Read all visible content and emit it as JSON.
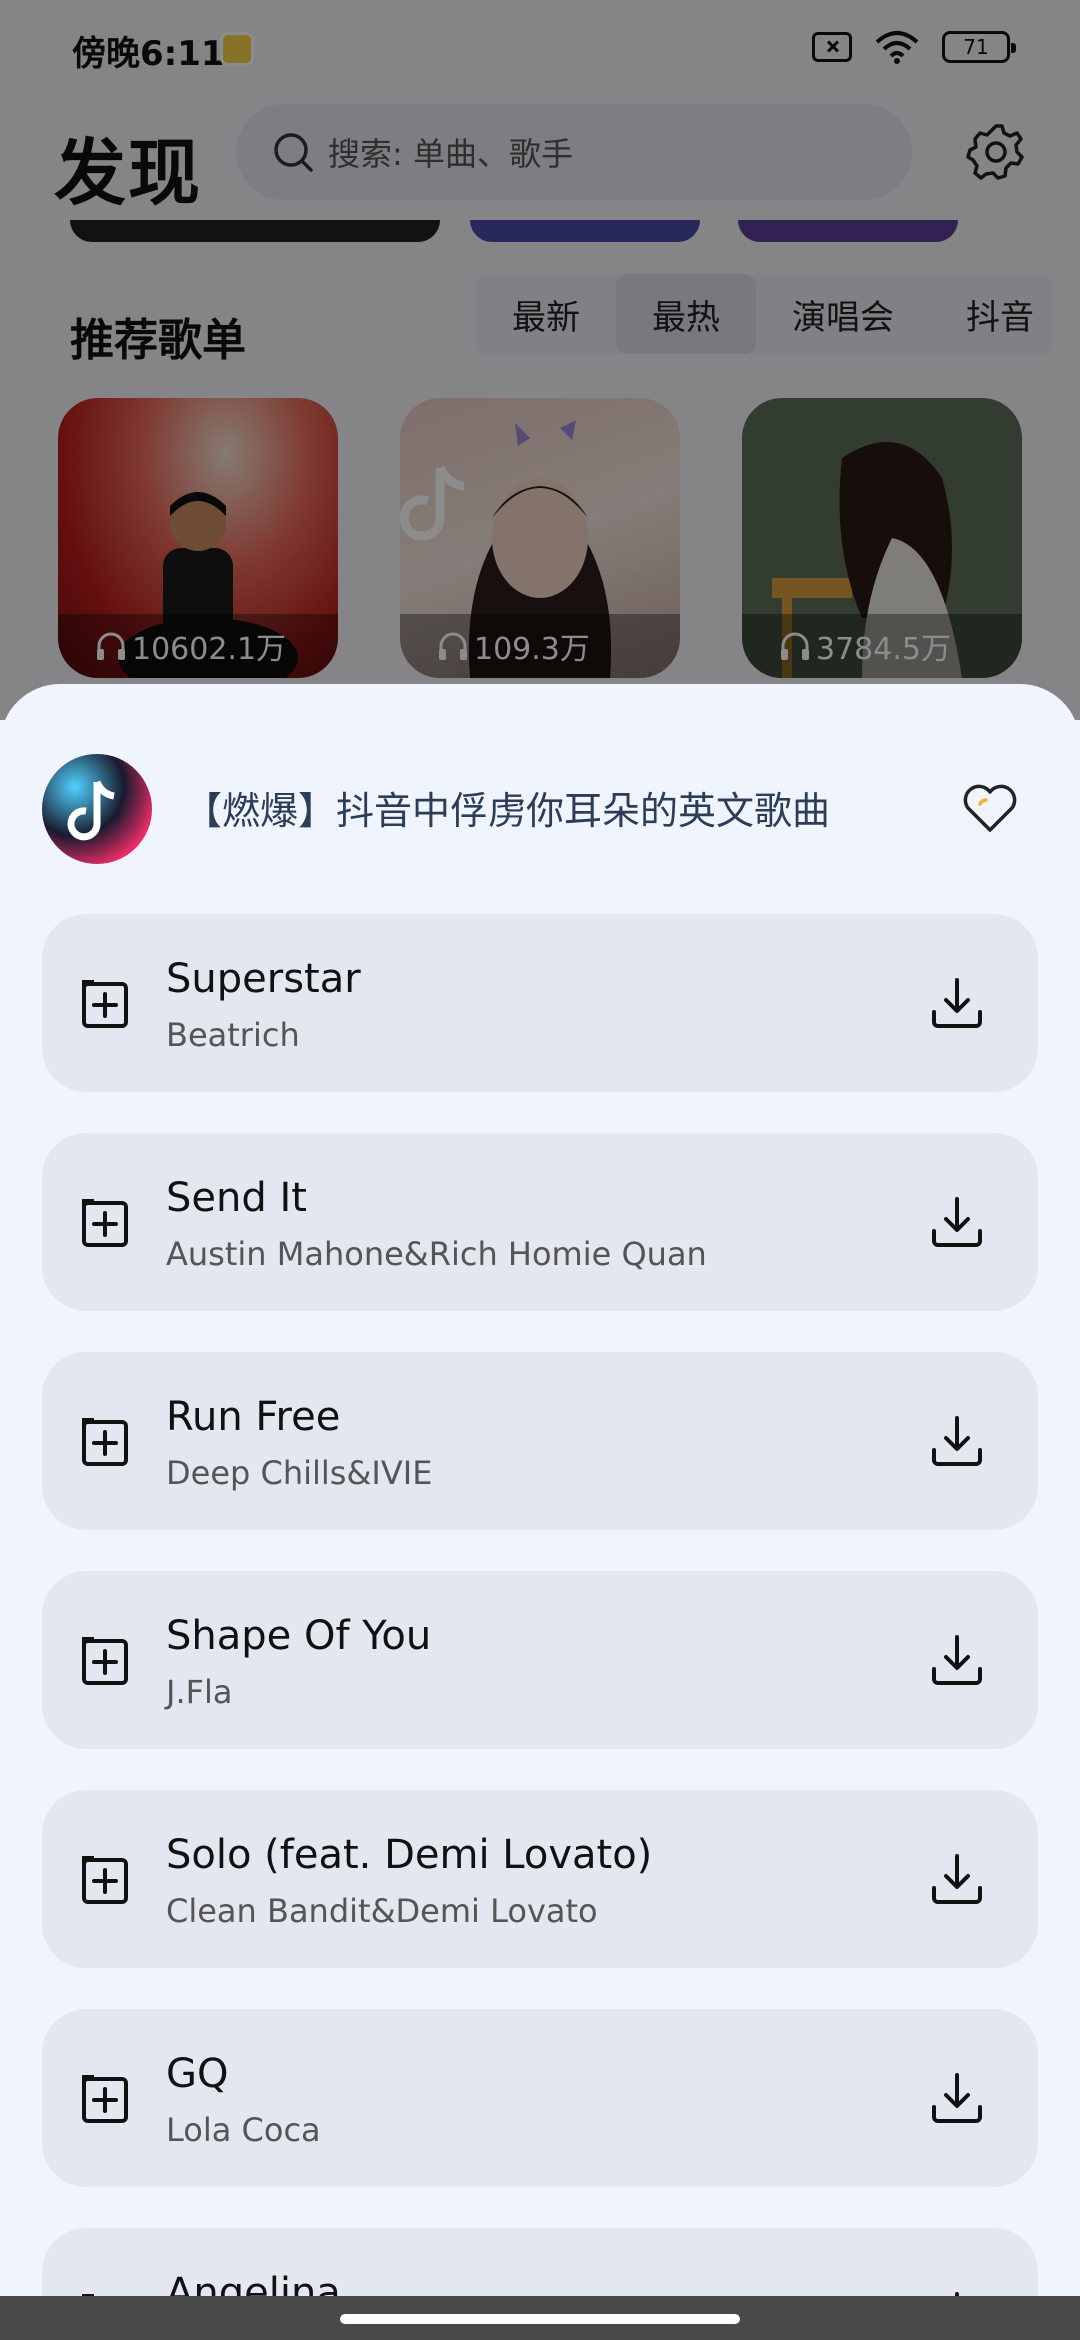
{
  "status_bar": {
    "time": "傍晚6:11",
    "battery": "71"
  },
  "header": {
    "title": "发现",
    "search_placeholder": "搜索: 单曲、歌手"
  },
  "section": {
    "title": "推荐歌单",
    "tabs": [
      {
        "label": "最新",
        "active": false
      },
      {
        "label": "最热",
        "active": true
      },
      {
        "label": "演唱会",
        "active": false
      },
      {
        "label": "抖音",
        "active": false
      }
    ]
  },
  "playlists": [
    {
      "play_count": "10602.1万",
      "art": "red-piano-performer"
    },
    {
      "play_count": "109.3万",
      "art": "tiktok-girl"
    },
    {
      "play_count": "3784.5万",
      "art": "dark-girl-illustration"
    }
  ],
  "sheet": {
    "playlist_name": "【燃爆】抖音中俘虏你耳朵的英文歌曲",
    "songs": [
      {
        "title": "Superstar",
        "artist": "Beatrich"
      },
      {
        "title": "Send It",
        "artist": "Austin Mahone&Rich Homie Quan"
      },
      {
        "title": "Run Free",
        "artist": "Deep Chills&IVIE"
      },
      {
        "title": "Shape Of You",
        "artist": "J.Fla"
      },
      {
        "title": "Solo (feat. Demi Lovato)",
        "artist": "Clean Bandit&Demi Lovato"
      },
      {
        "title": "GQ",
        "artist": "Lola Coca"
      },
      {
        "title": "Angelina",
        "artist": ""
      }
    ]
  },
  "colors": {
    "sheet_bg": "#f0f4fc",
    "song_card_bg": "#e3e8f0",
    "overlay": "rgba(0,0,0,0.45)"
  }
}
